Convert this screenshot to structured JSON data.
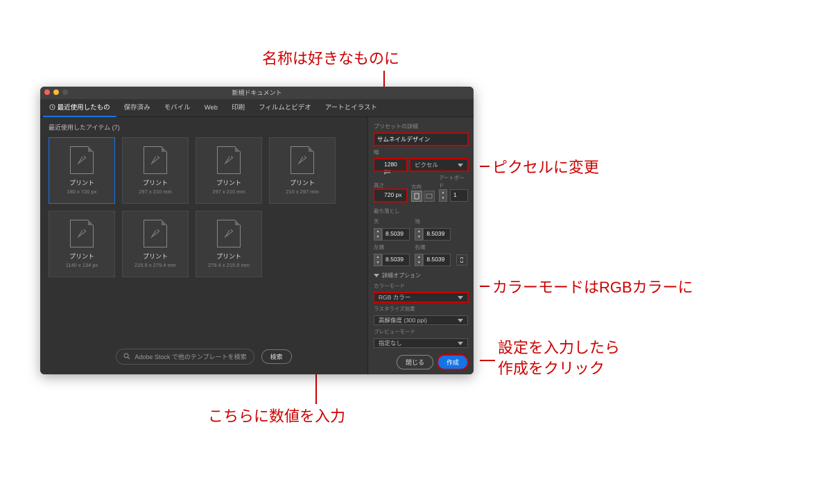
{
  "annotations": {
    "name": "名称は好きなものに",
    "unit": "ピクセルに変更",
    "size": "こちらに数値を入力",
    "color": "カラーモードはRGBカラーに",
    "create_1": "設定を入力したら",
    "create_2": "作成をクリック"
  },
  "dialog": {
    "title": "新規ドキュメント",
    "tabs": [
      "最近使用したもの",
      "保存済み",
      "モバイル",
      "Web",
      "印刷",
      "フィルムとビデオ",
      "アートとイラスト"
    ],
    "recent_header": "最近使用したアイテム (7)",
    "presets": [
      {
        "name": "プリント",
        "size": "180 x 720 px",
        "selected": true
      },
      {
        "name": "プリント",
        "size": "297 x 210 mm"
      },
      {
        "name": "プリント",
        "size": "297 x 210 mm"
      },
      {
        "name": "プリント",
        "size": "210 x 297 mm"
      },
      {
        "name": "プリント",
        "size": "1140 x 134 px"
      },
      {
        "name": "プリント",
        "size": "215.9 x 279.4 mm"
      },
      {
        "name": "プリント",
        "size": "279.4 x 215.9 mm"
      }
    ],
    "search_placeholder": "Adobe Stock で他のテンプレートを検索",
    "search_btn": "検索",
    "detail_header": "プリセットの詳細",
    "name_value": "サムネイルデザイン",
    "width_label": "幅",
    "width_value": "1280 px",
    "unit_value": "ピクセル",
    "height_label": "高さ",
    "height_value": "720 px",
    "orient_label": "方向",
    "artboard_label": "アートボード",
    "artboard_value": "1",
    "bleed_header": "裁ち落とし",
    "bleed_top": "天",
    "bleed_bottom": "地",
    "bleed_left": "左端",
    "bleed_right": "右端",
    "bleed_val": "8.5039",
    "advanced": "詳細オプション",
    "colormode_label": "カラーモード",
    "colormode_value": "RGB カラー",
    "raster_label": "ラスタライズ効果",
    "raster_value": "高解像度 (300 ppi)",
    "preview_label": "プレビューモード",
    "preview_value": "指定なし",
    "close_btn": "閉じる",
    "create_btn": "作成"
  }
}
